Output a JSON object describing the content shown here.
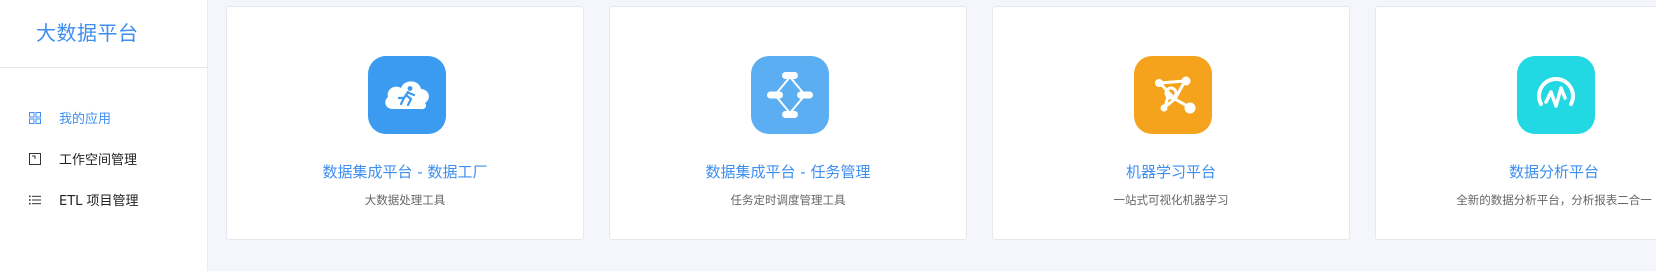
{
  "sidebar": {
    "brand": "大数据平台",
    "items": [
      {
        "label": "我的应用",
        "icon": "grid-icon",
        "active": true
      },
      {
        "label": "工作空间管理",
        "icon": "workspace-icon",
        "active": false
      },
      {
        "label": "ETL 项目管理",
        "icon": "list-icon",
        "active": false
      }
    ]
  },
  "apps": [
    {
      "title": "数据集成平台 - 数据工厂",
      "desc": "大数据处理工具",
      "icon": "cloud-runner-icon",
      "color": "#3a9bf0"
    },
    {
      "title": "数据集成平台 - 任务管理",
      "desc": "任务定时调度管理工具",
      "icon": "workflow-icon",
      "color": "#5caef2"
    },
    {
      "title": "机器学习平台",
      "desc": "一站式可视化机器学习",
      "icon": "network-nodes-icon",
      "color": "#f5a31c"
    },
    {
      "title": "数据分析平台",
      "desc": "全新的数据分析平台，分析报表二合一",
      "icon": "analytics-icon",
      "color": "#22d8e3"
    }
  ],
  "colors": {
    "accent": "#3d8ef0",
    "background": "#f4f6fb"
  }
}
